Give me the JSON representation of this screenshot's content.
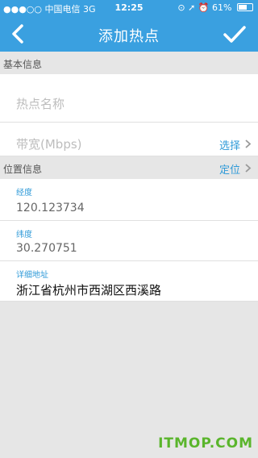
{
  "status_bar": {
    "carrier": "中国电信",
    "network": "3G",
    "time": "12:25",
    "battery_text": "61%",
    "battery_level": 0.61
  },
  "nav": {
    "title": "添加热点"
  },
  "basic_section": {
    "header": "基本信息",
    "name_placeholder": "热点名称",
    "bandwidth_placeholder": "带宽(Mbps)",
    "bandwidth_action": "选择"
  },
  "location_section": {
    "header": "位置信息",
    "action": "定位",
    "longitude_label": "经度",
    "longitude_value": "120.123734",
    "latitude_label": "纬度",
    "latitude_value": "30.270751",
    "address_label": "详细地址",
    "address_value": "浙江省杭州市西湖区西溪路"
  },
  "watermark": "ITMOP.COM",
  "colors": {
    "accent": "#3aa0e0",
    "link": "#2f9ad8",
    "watermark": "#5ab52c"
  }
}
